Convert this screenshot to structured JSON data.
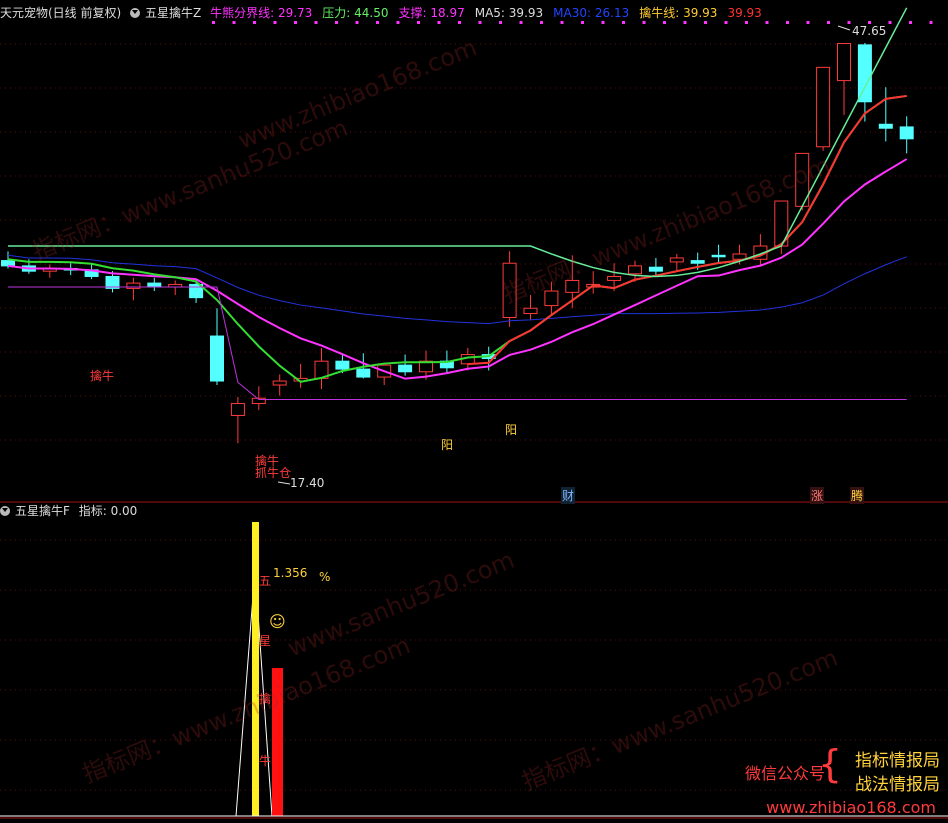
{
  "top_header": {
    "stock": "天元宠物(日线 前复权)",
    "indicator": "五星擒牛Z",
    "items": [
      {
        "label": "牛熊分界线: ",
        "value": "29.73",
        "color": "#ff33ff"
      },
      {
        "label": "压力: ",
        "value": "44.50",
        "color": "#66ee66"
      },
      {
        "label": "支撑: ",
        "value": "18.97",
        "color": "#ff33ff"
      },
      {
        "label": "MA5: ",
        "value": "39.93",
        "color": "#dddddd"
      },
      {
        "label": "MA30: ",
        "value": "26.13",
        "color": "#2244ff"
      },
      {
        "label": "擒牛线: ",
        "value": "39.93",
        "color": "#ffcc33"
      },
      {
        "label": "",
        "value": "39.93",
        "color": "#ff3333"
      }
    ]
  },
  "bottom_header": {
    "indicator": "五星擒牛F",
    "label": "指标: ",
    "value": "0.00"
  },
  "price_labels": {
    "high": "47.65",
    "low": "17.40"
  },
  "chart_annotations": {
    "qinniu": "擒牛",
    "jin_niu": "擒牛",
    "zhua_niu_cang": "抓牛仓",
    "yang1": "阳",
    "yang2": "阳",
    "cai": "财",
    "zhang": "涨",
    "teng": "腾"
  },
  "lower_annotations": {
    "percent_value": "1.356",
    "percent_sign": "%",
    "smiley": "☺",
    "v1": "五",
    "v2": "星",
    "v3": "擒",
    "v4": "牛"
  },
  "promo": {
    "wechat": "微信公众号",
    "brace": "{",
    "line1": "指标情报局",
    "line2": "战法情报局",
    "url": "www.zhibiao168.com"
  },
  "watermarks": [
    "www.zhibiao168.com",
    "指标网：www.sanhu520.com",
    "指标网：www.zhibiao168.com",
    "www.sanhu520.com"
  ],
  "chart_data": {
    "type": "candlestick",
    "ohlc": [
      [
        31.2,
        31.9,
        30.6,
        30.8
      ],
      [
        30.8,
        31.3,
        30.2,
        30.4
      ],
      [
        30.4,
        30.9,
        29.9,
        30.6
      ],
      [
        30.6,
        31.0,
        30.1,
        30.5
      ],
      [
        30.5,
        31.0,
        29.8,
        30.0
      ],
      [
        30.0,
        30.4,
        28.8,
        29.1
      ],
      [
        29.1,
        29.9,
        28.2,
        29.5
      ],
      [
        29.5,
        29.9,
        28.9,
        29.2
      ],
      [
        29.2,
        29.7,
        28.6,
        29.4
      ],
      [
        29.4,
        29.8,
        28.0,
        28.4
      ],
      [
        25.5,
        27.6,
        21.8,
        22.1
      ],
      [
        19.5,
        20.9,
        17.4,
        20.4
      ],
      [
        20.4,
        21.7,
        19.9,
        20.8
      ],
      [
        21.8,
        22.6,
        21.0,
        22.1
      ],
      [
        22.1,
        23.4,
        21.6,
        22.3
      ],
      [
        22.3,
        24.6,
        21.5,
        23.6
      ],
      [
        23.6,
        24.1,
        22.7,
        23.0
      ],
      [
        23.0,
        24.2,
        22.3,
        22.4
      ],
      [
        22.4,
        23.1,
        21.8,
        23.3
      ],
      [
        23.3,
        24.1,
        22.5,
        22.8
      ],
      [
        22.8,
        24.4,
        22.2,
        23.6
      ],
      [
        23.6,
        24.4,
        22.7,
        23.1
      ],
      [
        23.4,
        24.6,
        22.9,
        24.1
      ],
      [
        24.1,
        24.7,
        22.9,
        23.8
      ],
      [
        26.9,
        31.9,
        26.2,
        31.0
      ],
      [
        27.2,
        28.6,
        26.7,
        27.6
      ],
      [
        27.8,
        29.6,
        27.1,
        28.9
      ],
      [
        28.8,
        31.6,
        27.6,
        29.7
      ],
      [
        29.2,
        30.4,
        28.7,
        29.4
      ],
      [
        29.7,
        31.0,
        28.9,
        30.0
      ],
      [
        30.2,
        31.2,
        29.6,
        30.8
      ],
      [
        30.7,
        31.4,
        30.0,
        30.4
      ],
      [
        31.1,
        31.7,
        30.4,
        31.4
      ],
      [
        31.2,
        31.8,
        30.5,
        31.0
      ],
      [
        31.6,
        32.4,
        31.0,
        31.5
      ],
      [
        31.3,
        32.4,
        30.9,
        31.7
      ],
      [
        31.3,
        33.2,
        30.9,
        32.3
      ],
      [
        32.3,
        35.0,
        31.7,
        35.7
      ],
      [
        35.3,
        38.6,
        35.0,
        39.3
      ],
      [
        39.8,
        45.1,
        39.5,
        45.8
      ],
      [
        44.8,
        47.1,
        42.2,
        47.6
      ],
      [
        47.5,
        47.65,
        41.7,
        43.2
      ],
      [
        41.5,
        44.3,
        40.2,
        41.2
      ],
      [
        41.3,
        42.1,
        39.3,
        40.4
      ]
    ],
    "ylim": [
      15,
      49
    ]
  }
}
